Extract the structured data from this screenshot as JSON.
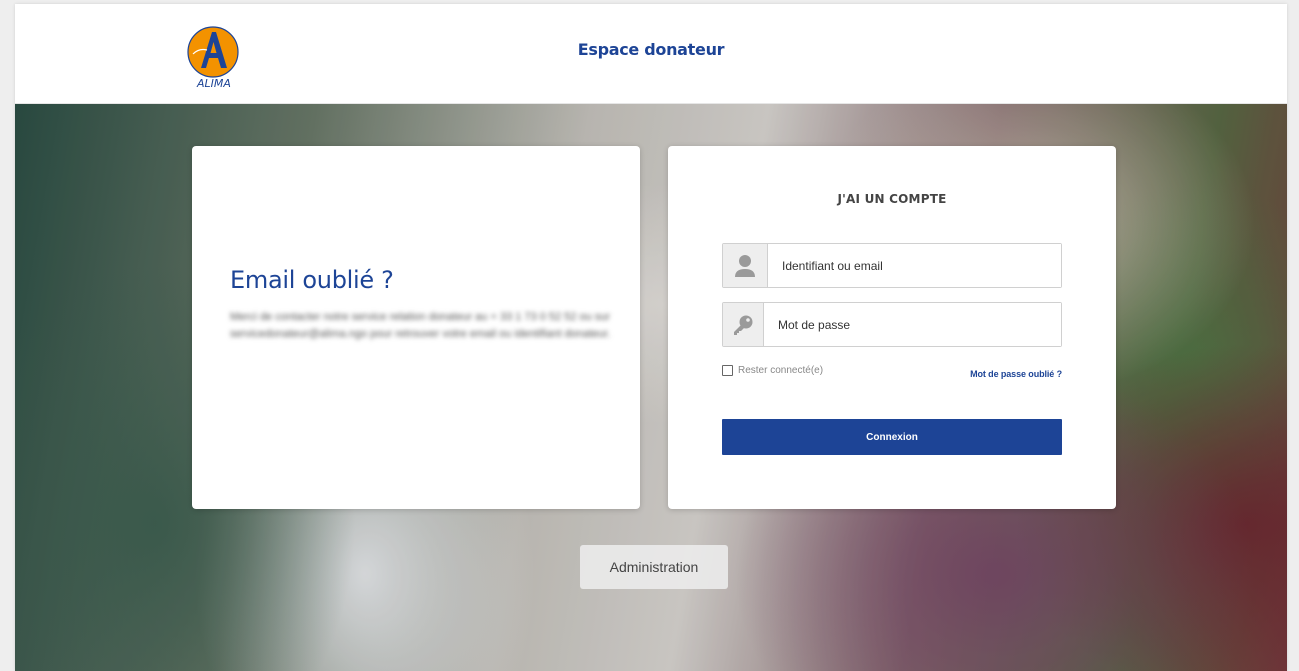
{
  "header": {
    "title": "Espace donateur",
    "logo_text": "ALIMA"
  },
  "forgot_email": {
    "title": "Email oublié ?",
    "message": "Merci de contacter notre service relation donateur au + 33 1 73 0 52 52 ou sur servicedonateur@alima.ngo pour retrouver votre email ou identifiant donateur."
  },
  "login": {
    "title": "J'AI UN COMPTE",
    "username_placeholder": "Identifiant ou email",
    "password_placeholder": "Mot de passe",
    "remember_label": "Rester connecté(e)",
    "forgot_password_link": "Mot de passe oublié ?",
    "submit_label": "Connexion",
    "user_icon": "user-icon",
    "key_icon": "key-icon"
  },
  "admin": {
    "label": "Administration"
  },
  "colors": {
    "brand_blue": "#1d4496",
    "logo_orange": "#f39200",
    "field_icon_bg": "#eeeeee"
  }
}
